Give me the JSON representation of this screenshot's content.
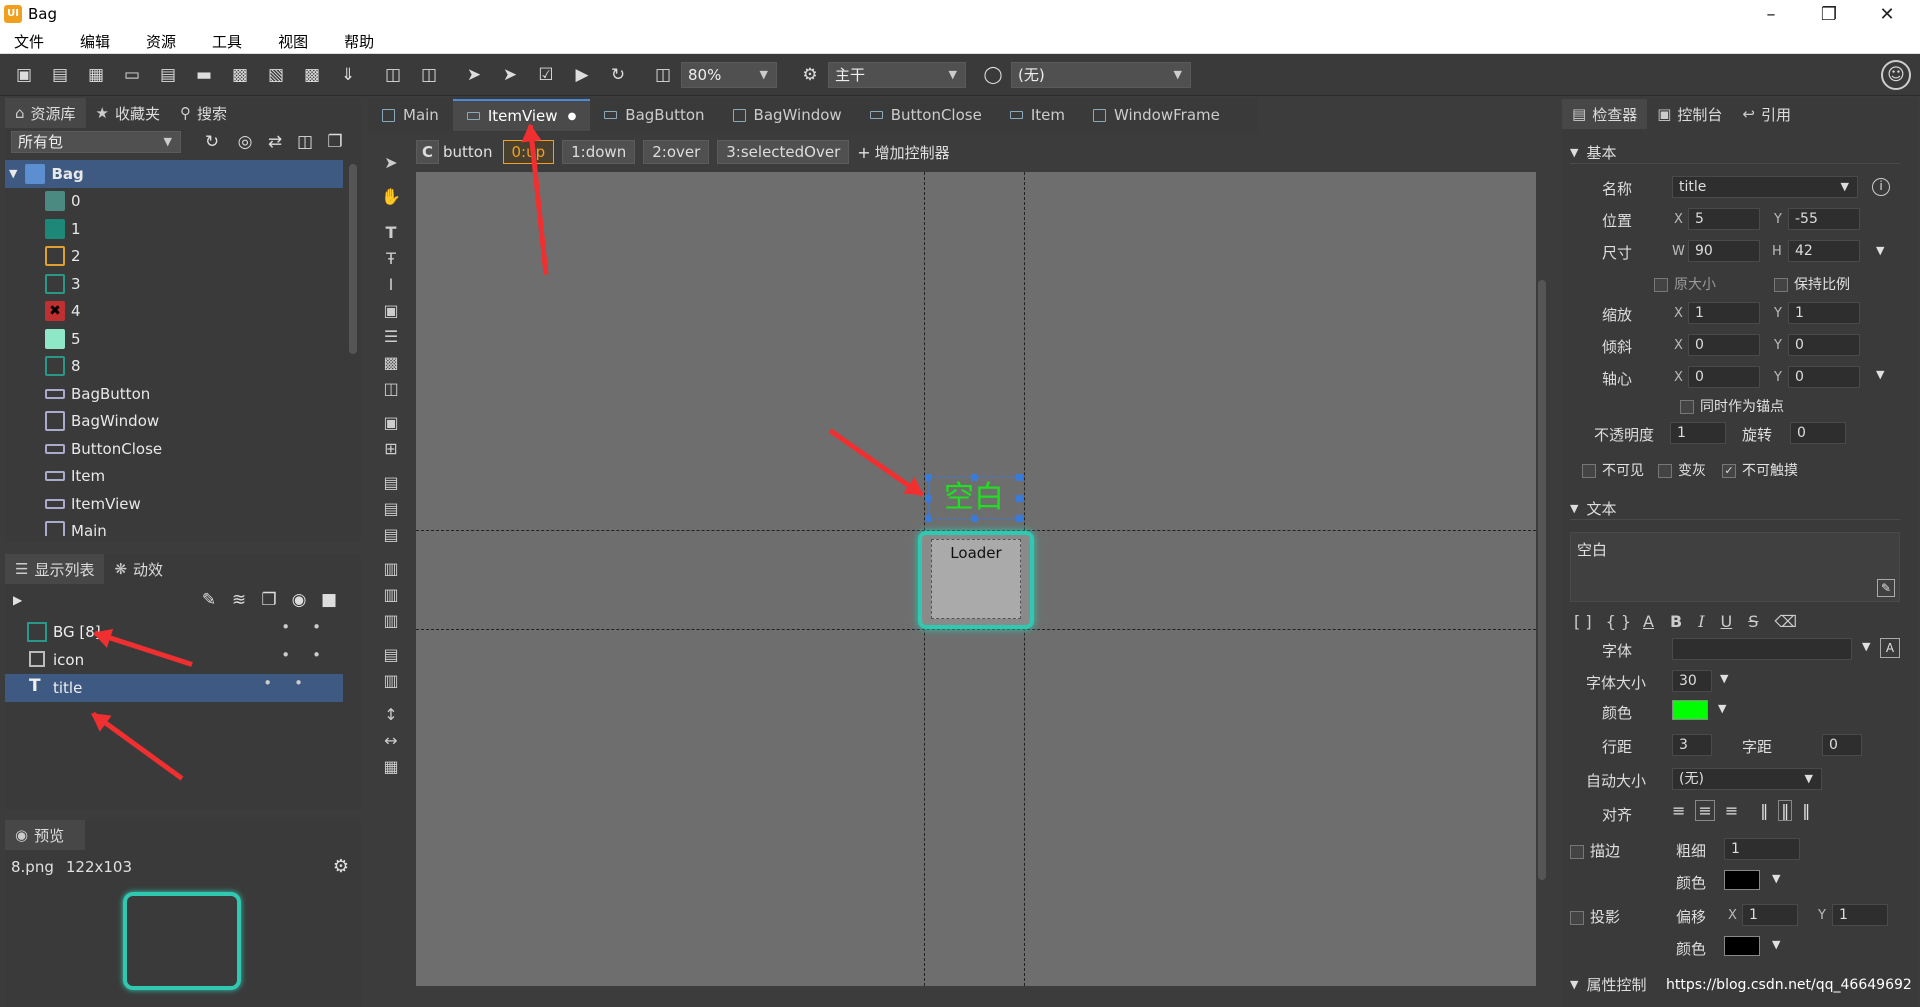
{
  "window": {
    "title": "Bag",
    "logo": "UI"
  },
  "menu": [
    "文件",
    "编辑",
    "资源",
    "工具",
    "视图",
    "帮助"
  ],
  "toolbar": {
    "zoom": "80%",
    "branch": "主干",
    "lang": "(无)"
  },
  "left": {
    "tabs": [
      "资源库",
      "收藏夹",
      "搜索"
    ],
    "package_filter": "所有包",
    "tree_root": "Bag",
    "tree_items": [
      "0",
      "1",
      "2",
      "3",
      "4",
      "5",
      "8",
      "BagButton",
      "BagWindow",
      "ButtonClose",
      "Item",
      "ItemView",
      "Main"
    ],
    "display_tabs": [
      "显示列表",
      "动效"
    ],
    "layers": [
      "BG [8]",
      "icon",
      "title"
    ],
    "preview_tab": "预览",
    "preview_file": "8.png",
    "preview_size": "122x103"
  },
  "docs": {
    "tabs": [
      "Main",
      "ItemView",
      "BagButton",
      "BagWindow",
      "ButtonClose",
      "Item",
      "WindowFrame"
    ],
    "controller_label": "C",
    "controller": "button",
    "states": [
      "0:up",
      "1:down",
      "2:over",
      "3:selectedOver"
    ],
    "add_controller": "增加控制器"
  },
  "canvas": {
    "title_text": "空白",
    "loader_label": "Loader",
    "colors": {
      "title": "#1ee01e",
      "frame": "#30c8b0"
    }
  },
  "inspector": {
    "tabs": [
      "检查器",
      "控制台",
      "引用"
    ],
    "basic": "基本",
    "name_label": "名称",
    "name": "title",
    "pos_label": "位置",
    "pos_x": "5",
    "pos_y": "-55",
    "size_label": "尺寸",
    "size_w": "90",
    "size_h": "42",
    "orig_size": "原大小",
    "keep_ratio": "保持比例",
    "scale_label": "缩放",
    "scale_x": "1",
    "scale_y": "1",
    "skew_label": "倾斜",
    "skew_x": "0",
    "skew_y": "0",
    "pivot_label": "轴心",
    "pivot_x": "0",
    "pivot_y": "0",
    "anchor": "同时作为锚点",
    "alpha_label": "不透明度",
    "alpha": "1",
    "rotation_label": "旋转",
    "rotation": "0",
    "invisible": "不可见",
    "gray": "变灰",
    "untouchable": "不可触摸",
    "text_section": "文本",
    "text_value": "空白",
    "font_label": "字体",
    "font": "",
    "font_size_label": "字体大小",
    "font_size": "30",
    "color_label": "颜色",
    "color": "#00ff00",
    "leading_label": "行距",
    "leading": "3",
    "letter_label": "字距",
    "letter": "0",
    "autosize_label": "自动大小",
    "autosize": "(无)",
    "align_label": "对齐",
    "stroke_label": "描边",
    "thickness_label": "粗细",
    "thickness": "1",
    "stroke_color_label": "颜色",
    "stroke_color": "#000000",
    "shadow_label": "投影",
    "offset_label": "偏移",
    "shadow_x": "1",
    "shadow_y": "1",
    "shadow_color_label": "颜色",
    "shadow_color": "#000000",
    "prop_ctrl": "属性控制",
    "footer_url": "https://blog.csdn.net/qq_46649692"
  },
  "axes": {
    "x": "X",
    "y": "Y",
    "w": "W",
    "h": "H"
  }
}
